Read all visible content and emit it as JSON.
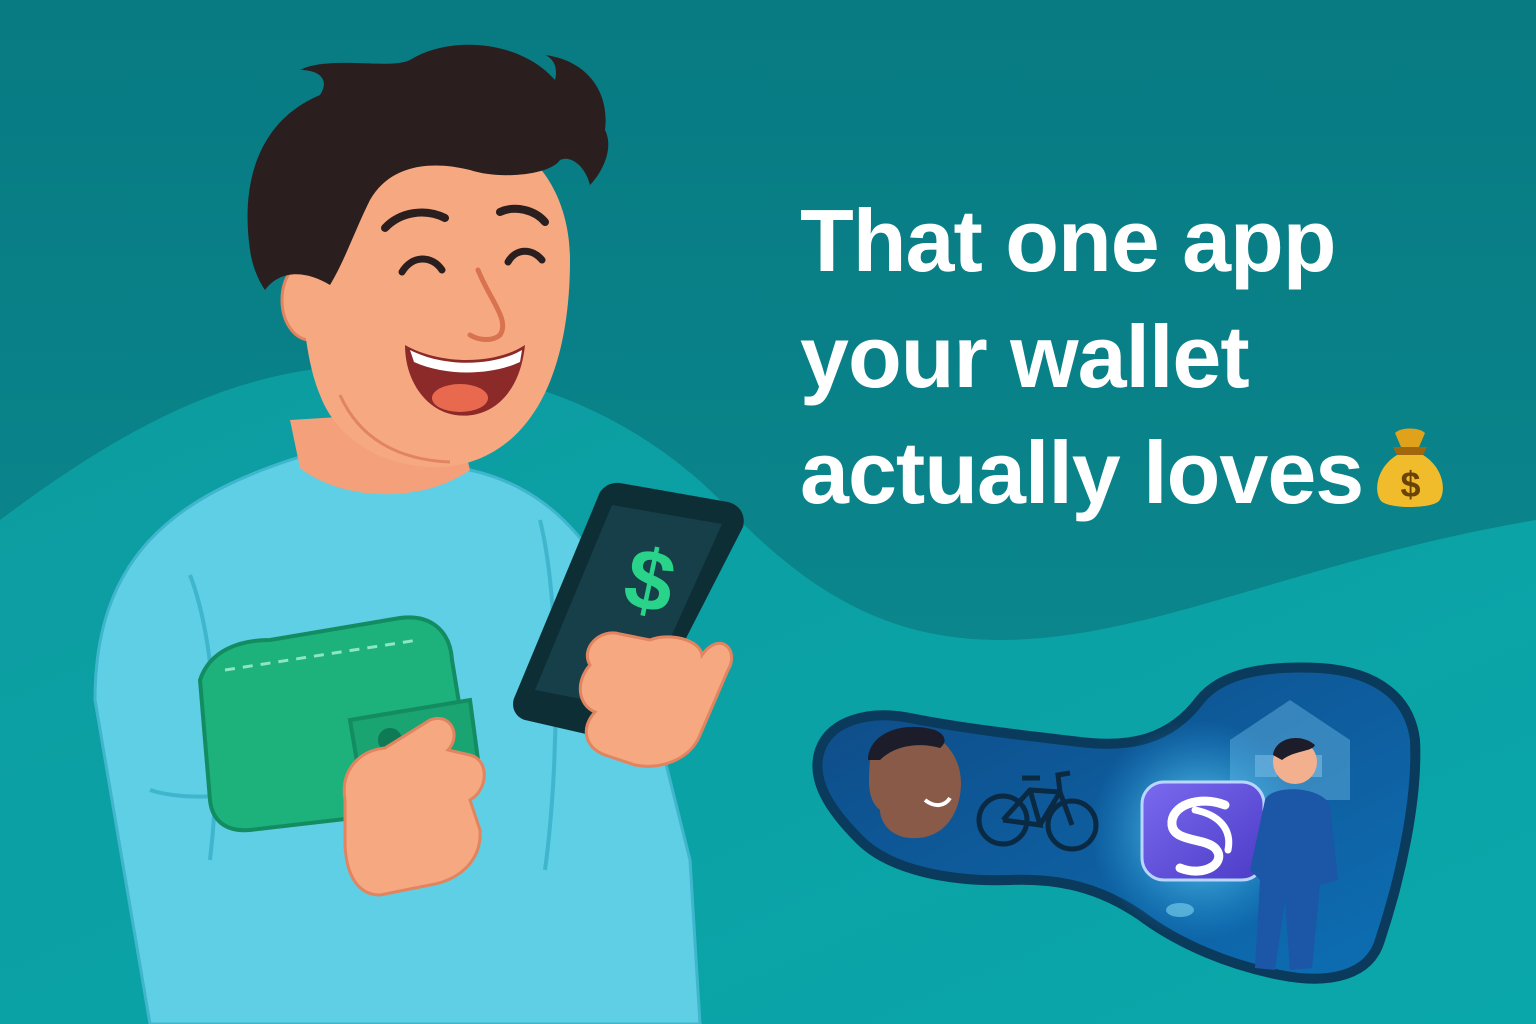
{
  "headline": {
    "line1": "That one app",
    "line2": "your wallet",
    "line3": "actually loves",
    "emoji_icon": "money-bag-icon"
  },
  "phone_screen_symbol": "$",
  "money_bag_symbol": "$",
  "app_logo_icon": "app-s-logo-icon",
  "colors": {
    "background_dark": "#087f86",
    "background_wave": "#0a9fa3",
    "headline_text": "#ffffff",
    "shirt": "#5ecfe4",
    "skin": "#f6a880",
    "hair": "#2a1e1e",
    "wallet": "#1db17c",
    "phone": "#13363f",
    "dollar_green": "#2ad38a",
    "app_logo": "#6a5ce0"
  }
}
